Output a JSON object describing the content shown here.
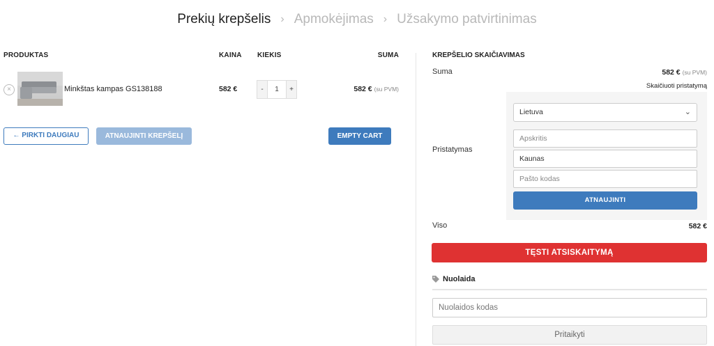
{
  "breadcrumb": {
    "step1": "Prekių krepšelis",
    "step2": "Apmokėjimas",
    "step3": "Užsakymo patvirtinimas",
    "separator": "›"
  },
  "cart": {
    "headers": {
      "product": "PRODUKTAS",
      "price": "KAINA",
      "qty": "KIEKIS",
      "total": "SUMA"
    },
    "items": [
      {
        "remove_symbol": "×",
        "name": "Minkštas kampas GS138188",
        "price": "582 €",
        "qty_minus": "-",
        "qty": "1",
        "qty_plus": "+",
        "total": "582 €",
        "total_note": "(su PVM)"
      }
    ],
    "buttons": {
      "continue": "← PIRKTI DAUGIAU",
      "update": "ATNAUJINTI KREPŠELĮ",
      "empty": "EMPTY CART"
    }
  },
  "totals": {
    "title": "KREPŠELIO SKAIČIAVIMAS",
    "subtotal_label": "Suma",
    "subtotal_value": "582 €",
    "subtotal_note": "(su PVM)",
    "calc_shipping_link": "Skaičiuoti pristatymą",
    "shipping_label": "Pristatymas",
    "shipping_form": {
      "country": "Lietuva",
      "state_placeholder": "Apskritis",
      "city": "Kaunas",
      "postcode_placeholder": "Pašto kodas",
      "update_button": "ATNAUJINTI"
    },
    "total_label": "Viso",
    "total_value": "582 €",
    "checkout_button": "TĘSTI ATSISKAITYMĄ"
  },
  "coupon": {
    "title": "Nuolaida",
    "placeholder": "Nuolaidos kodas",
    "apply_button": "Pritaikyti"
  },
  "colors": {
    "primary": "#3e7bbd",
    "primary_disabled": "#9ab9dc",
    "checkout": "#df3232"
  }
}
